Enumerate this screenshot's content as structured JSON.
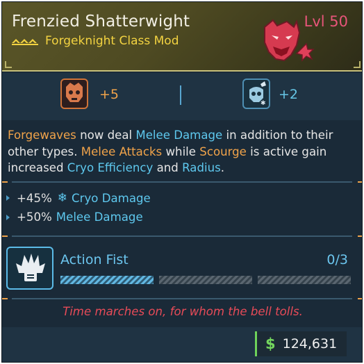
{
  "item": {
    "name": "Frenzied Shatterwight",
    "class_type": "Forgeknight Class Mod",
    "level": "Lvl 50",
    "rarity_icon": "rarity-chevrons-icon",
    "head_icon": "demon-head-icon",
    "colors": {
      "name": "#f2efe4",
      "subtitle": "#f3d341",
      "level": "#e8557a",
      "header_bg": "#56522a"
    }
  },
  "skills": [
    {
      "icon": "forge-skull-icon",
      "bonus": "+5",
      "color": "#f0a34a"
    },
    {
      "icon": "ice-skull-icon",
      "bonus": "+2",
      "color": "#66c6e6"
    }
  ],
  "description": {
    "p1": "Forgewaves",
    "p2": " now deal ",
    "p3": "Melee Damage",
    "p4": " in addition to their other types. ",
    "p5": "Melee Attacks",
    "p6": " while ",
    "p7": "Scourge",
    "p8": " is active gain increased ",
    "p9": "Cryo Efficiency",
    "p10": " and ",
    "p11": "Radius",
    "p12": "."
  },
  "stats": [
    {
      "value": "+45%",
      "label": "Cryo Damage",
      "icon": "snowflake-icon"
    },
    {
      "value": "+50%",
      "label": "Melee Damage"
    }
  ],
  "augment": {
    "name": "Action Fist",
    "icon": "fist-icon",
    "progress_text": "0/3",
    "pips_filled": 1,
    "pips_total": 3
  },
  "flavor_text": "Time marches on, for whom the bell tolls.",
  "price": {
    "icon": "dollar-icon",
    "symbol": "$",
    "value": "124,631"
  }
}
